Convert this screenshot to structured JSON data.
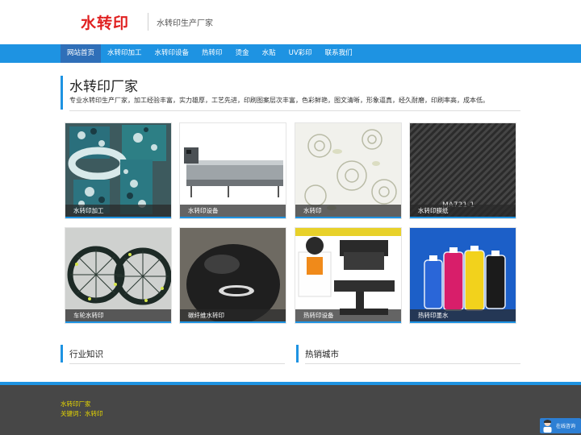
{
  "header": {
    "logo_text": "水转印",
    "slogan": "水转印生产厂家"
  },
  "nav": {
    "items": [
      "网站首页",
      "水转印加工",
      "水转印设备",
      "热转印",
      "烫金",
      "水贴",
      "UV彩印",
      "联系我们"
    ],
    "active_index": 0
  },
  "intro": {
    "title": "水转印厂家",
    "description": "专业水转印生产厂家，加工经验丰富，实力雄厚，工艺先进，印刷图案层次丰富，色彩鲜艳，图文清晰，形象逼真，经久耐磨，印刷率高，成本低。"
  },
  "products": [
    {
      "caption": "水转印加工"
    },
    {
      "caption": "水转印设备"
    },
    {
      "caption": "水转印"
    },
    {
      "caption": "水转印膜纸",
      "image_text": "MA721-1"
    },
    {
      "caption": "车轮水转印"
    },
    {
      "caption": "碳纤维水转印"
    },
    {
      "caption": "热转印设备"
    },
    {
      "caption": "热转印墨水"
    }
  ],
  "sections": {
    "industry": "行业知识",
    "cities": "热销城市"
  },
  "footer": {
    "company": "水转印厂家",
    "keywords": "关键词：水转印"
  },
  "chat": {
    "label": "在线咨询"
  },
  "colors": {
    "accent": "#1e93e2",
    "logo": "#e02020",
    "footer_bg": "#474747",
    "footer_text": "#e8d800"
  }
}
